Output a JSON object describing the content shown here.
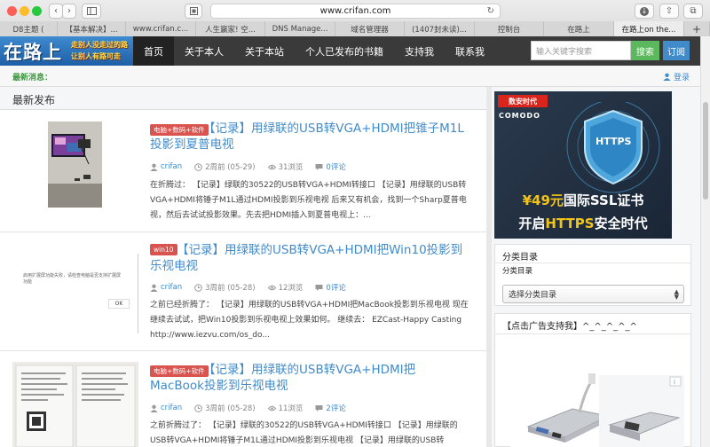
{
  "browser": {
    "url": "www.crifan.com",
    "tabs": [
      "D8主题 (",
      "【基本解决】...",
      "www.crifan.c...",
      "人生赢家! 空...",
      "DNS Manage...",
      "域名管理器",
      "(1407封未读)...",
      "控制台",
      "在路上",
      "在路上on the..."
    ],
    "active_tab_index": 9
  },
  "site": {
    "logo": {
      "big": "在路上",
      "slogan1": "走别人没走过的路",
      "slogan2": "让别人有路可走"
    },
    "menu": [
      "首页",
      "关于本人",
      "关于本站",
      "个人已发布的书籍",
      "支持我",
      "联系我"
    ],
    "search_placeholder": "输入关键字搜索",
    "search_button": "搜索",
    "subscribe_button": "订阅",
    "news_label": "最新消息：",
    "login": "登录"
  },
  "main": {
    "section_title": "最新发布",
    "posts": [
      {
        "badge": "电脑+数码+软件",
        "title": "【记录】用绿联的USB转VGA+HDMI把锥子M1L投影到夏普电视",
        "author": "crifan",
        "time": "2周前 (05-29)",
        "views": "31浏览",
        "comments": "0评论",
        "excerpt": "在折腾过： 【记录】绿联的30522的USB转VGA+HDMI转接口 【记录】用绿联的USB转VGA+HDMI将锤子M1L通过HDMI投影到乐视电视 后来又有机会，找到一个Sharp夏普电视，然后去试试投影效果。先去把HDMI插入到夏普电视上：..."
      },
      {
        "badge": "win10",
        "title": "【记录】用绿联的USB转VGA+HDMI把Win10投影到乐视电视",
        "author": "crifan",
        "time": "3周前 (05-28)",
        "views": "12浏览",
        "comments": "0评论",
        "excerpt": "之前已经折腾了： 【记录】用绿联的USB转VGA+HDMI把MacBook投影到乐视电视 现在继续去试试，把Win10投影到乐视电视上效果如何。 继续去： EZCast-Happy Casting http://www.iezvu.com/os_do...",
        "thumb_text1": "启用扩展屏功能失败，请检查电脑是否支持扩展屏功能",
        "thumb_ok": "OK"
      },
      {
        "badge": "电脑+数码+软件",
        "title": "【记录】用绿联的USB转VGA+HDMI把MacBook投影到乐视电视",
        "author": "crifan",
        "time": "3周前 (05-28)",
        "views": "11浏览",
        "comments": "2评论",
        "excerpt": "之前折腾过了： 【记录】绿联的30522的USB转VGA+HDMI转接口 【记录】用绿联的USB转VGA+HDMI将锤子M1L通过HDMI投影到乐视电视 【记录】用绿联的USB转VGA+HDMI将"
      }
    ]
  },
  "sidebar": {
    "ad": {
      "brand": "数安时代",
      "comodo": "COMODO",
      "shield_label": "HTTPS",
      "line1_price": "¥49元",
      "line1_rest": "国际SSL证书",
      "line2_a": "开启",
      "line2_b": "HTTPS",
      "line2_c": "安全时代"
    },
    "category_widget": {
      "title": "分类目录",
      "label": "分类目录",
      "select": "选择分类目录"
    },
    "support_widget": {
      "title": "【点击广告支持我】^_^_^_^_^"
    }
  },
  "colors": {
    "nav_bg": "#3a3a3a",
    "link": "#428bca",
    "badge": "#d9534f",
    "green": "#5cb85c"
  }
}
